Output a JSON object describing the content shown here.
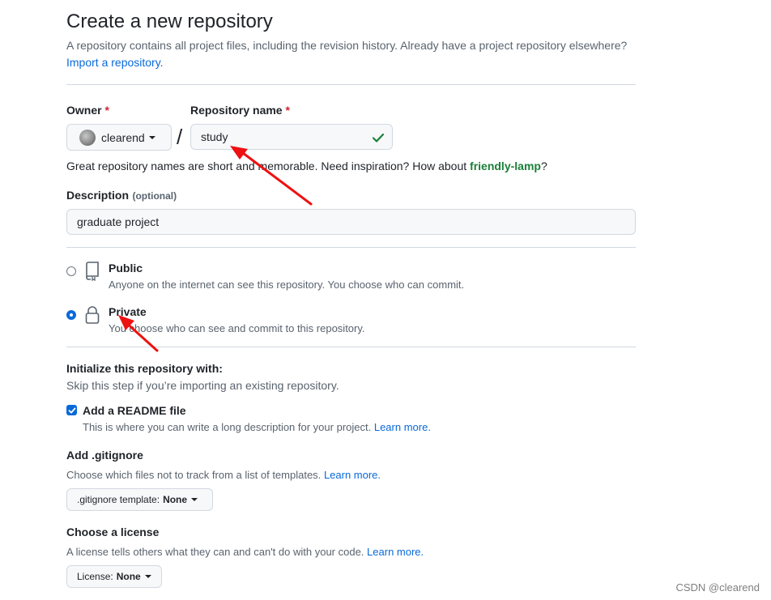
{
  "page": {
    "title": "Create a new repository",
    "intro_text": "A repository contains all project files, including the revision history. Already have a project repository elsewhere?",
    "import_link": "Import a repository."
  },
  "owner": {
    "label": "Owner",
    "required_mark": "*",
    "value": "clearend"
  },
  "separator": "/",
  "repo_name": {
    "label": "Repository name",
    "required_mark": "*",
    "value": "study"
  },
  "suggestion": {
    "text": "Great repository names are short and memorable. Need inspiration? How about",
    "name": "friendly-lamp",
    "suffix": "?"
  },
  "description": {
    "label": "Description",
    "optional": "(optional)",
    "value": "graduate project"
  },
  "visibility": {
    "public": {
      "label": "Public",
      "desc": "Anyone on the internet can see this repository. You choose who can commit.",
      "selected": false
    },
    "private": {
      "label": "Private",
      "desc": "You choose who can see and commit to this repository.",
      "selected": true
    }
  },
  "init": {
    "heading": "Initialize this repository with:",
    "subtext": "Skip this step if you’re importing an existing repository.",
    "readme": {
      "label": "Add a README file",
      "desc": "This is where you can write a long description for your project.",
      "link": "Learn more.",
      "checked": true
    }
  },
  "gitignore": {
    "heading": "Add .gitignore",
    "desc": "Choose which files not to track from a list of templates.",
    "link": "Learn more.",
    "button_prefix": ".gitignore template:",
    "button_value": "None"
  },
  "license": {
    "heading": "Choose a license",
    "desc": "A license tells others what they can and can't do with your code.",
    "link": "Learn more.",
    "button_prefix": "License:",
    "button_value": "None"
  },
  "watermark": "CSDN @clearend",
  "colors": {
    "accent": "#0969da",
    "success": "#1a7f37",
    "danger": "#d1242f",
    "annotation_arrow": "#ee1111"
  }
}
